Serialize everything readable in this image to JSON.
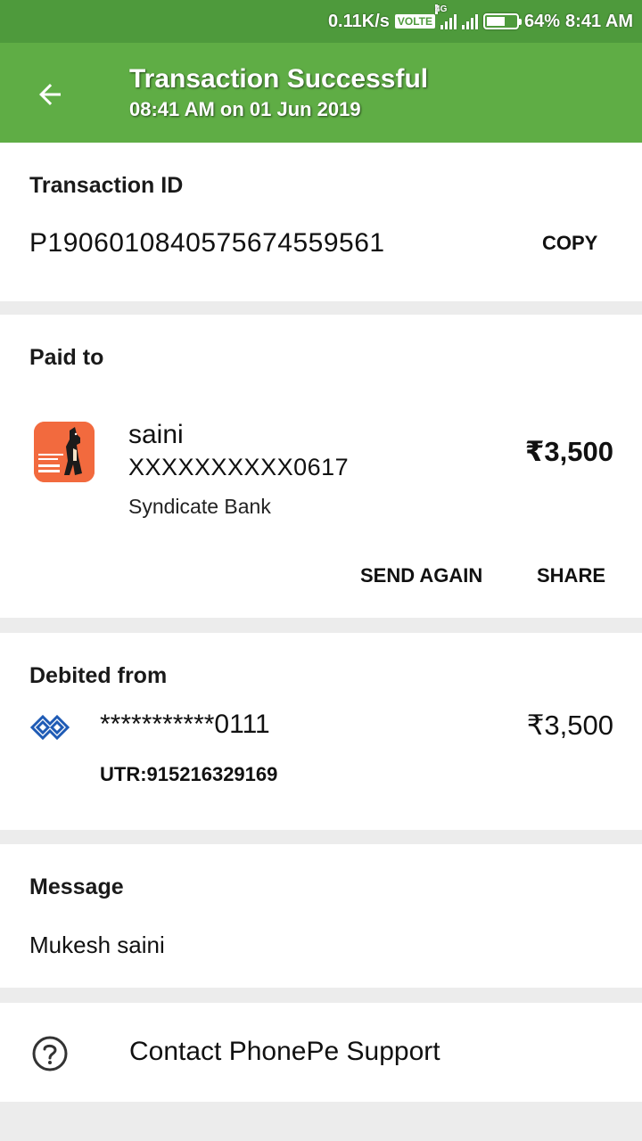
{
  "status_bar": {
    "speed": "0.11K/s",
    "volte": "VOLTE",
    "network": "4G",
    "battery_pct": "64%",
    "battery_level": 0.64,
    "time": "8:41 AM"
  },
  "header": {
    "title": "Transaction Successful",
    "subtitle": "08:41 AM on 01 Jun 2019",
    "color": "#5fad45"
  },
  "transaction": {
    "label": "Transaction ID",
    "id": "P1906010840575674559561",
    "copy_label": "COPY"
  },
  "paid_to": {
    "label": "Paid to",
    "name": "saini",
    "account": "XXXXXXXXXX0617",
    "bank": "Syndicate Bank",
    "amount": "₹3,500",
    "logo_icon": "faithful-friendly-dog-logo",
    "send_again_label": "SEND AGAIN",
    "share_label": "SHARE"
  },
  "debited_from": {
    "label": "Debited from",
    "account": "***********0111",
    "amount": "₹3,500",
    "utr": "UTR:915216329169",
    "bank_icon": "bank-logo-icon"
  },
  "message": {
    "label": "Message",
    "text": "Mukesh saini"
  },
  "support": {
    "label": "Contact PhonePe Support",
    "icon": "help-icon"
  }
}
